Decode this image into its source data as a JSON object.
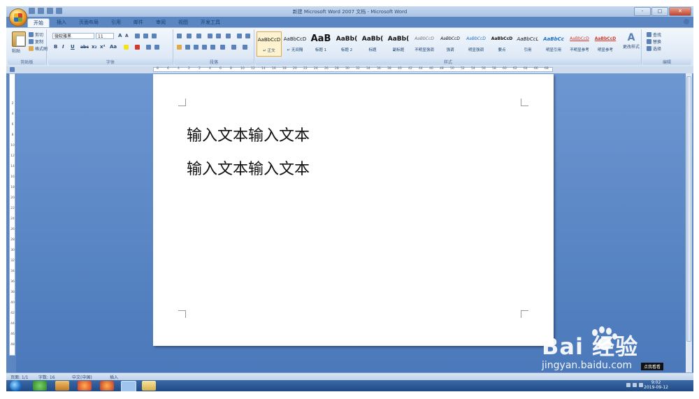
{
  "window": {
    "title": "新建 Microsoft Word 2007 文档 - Microsoft Word",
    "controls": [
      "-",
      "□",
      "✕"
    ]
  },
  "tabs": [
    "开始",
    "插入",
    "页面布局",
    "引用",
    "邮件",
    "审阅",
    "视图",
    "开发工具"
  ],
  "active_tab": "开始",
  "clipboard": {
    "paste": "粘贴",
    "cut": "剪切",
    "copy": "复制",
    "format_painter": "格式刷",
    "label": "剪贴板"
  },
  "font": {
    "name": "微软雅黑",
    "size": "11",
    "label": "字体",
    "buttons": [
      "B",
      "I",
      "U",
      "abc",
      "x₂",
      "x²",
      "Aa"
    ]
  },
  "paragraph": {
    "label": "段落"
  },
  "styles": {
    "label": "样式",
    "items": [
      {
        "sample": "AaBbCcD",
        "name": "↵ 正文"
      },
      {
        "sample": "AaBbCcD",
        "name": "↵ 无间隔"
      },
      {
        "sample": "AaB",
        "name": "标题 1"
      },
      {
        "sample": "AaBb(",
        "name": "标题 2"
      },
      {
        "sample": "AaBb(",
        "name": "标题"
      },
      {
        "sample": "AaBb(",
        "name": "副标题"
      },
      {
        "sample": "AaBbCcD",
        "name": "不明显强调"
      },
      {
        "sample": "AaBbCcD",
        "name": "强调"
      },
      {
        "sample": "AaBbCcD",
        "name": "明显强调"
      },
      {
        "sample": "AaBbCcD",
        "name": "要点"
      },
      {
        "sample": "AaBbCcL",
        "name": "引用"
      },
      {
        "sample": "AaBbCc",
        "name": "明显引用"
      },
      {
        "sample": "AaBbCcD",
        "name": "不明显参考"
      },
      {
        "sample": "AaBbCcD",
        "name": "明显参考"
      }
    ],
    "change_styles": "更改样式"
  },
  "editing": {
    "label": "编辑",
    "find": "查找",
    "replace": "替换",
    "select": "选择"
  },
  "ruler_numbers": [
    "8",
    "6",
    "4",
    "2",
    "2",
    "4",
    "6",
    "8",
    "10",
    "12",
    "14",
    "16",
    "18",
    "20",
    "22",
    "24",
    "26",
    "28",
    "30",
    "32",
    "34",
    "36",
    "38",
    "40",
    "42",
    "44",
    "46",
    "48",
    "50",
    "52",
    "54",
    "56",
    "58",
    "60",
    "62",
    "64",
    "66",
    "68"
  ],
  "vruler_numbers": [
    "2",
    "4",
    "6",
    "8",
    "10",
    "12",
    "14",
    "16",
    "18",
    "20",
    "22",
    "24",
    "26",
    "28",
    "30",
    "32",
    "34",
    "36",
    "38",
    "40",
    "42",
    "44",
    "46",
    "48"
  ],
  "document": {
    "lines": [
      "输入文本输入文本",
      "输入文本输入文本"
    ]
  },
  "status": {
    "page": "页面: 1/1",
    "words": "字数: 16",
    "lang": "中文(中国)",
    "mode": "插入",
    "zoom_hint": "点我看看"
  },
  "taskbar": {
    "time": "9:02",
    "date": "2019-09-12"
  },
  "watermark": {
    "brand": "Bai  经验",
    "url": "jingyan.baidu.com"
  }
}
